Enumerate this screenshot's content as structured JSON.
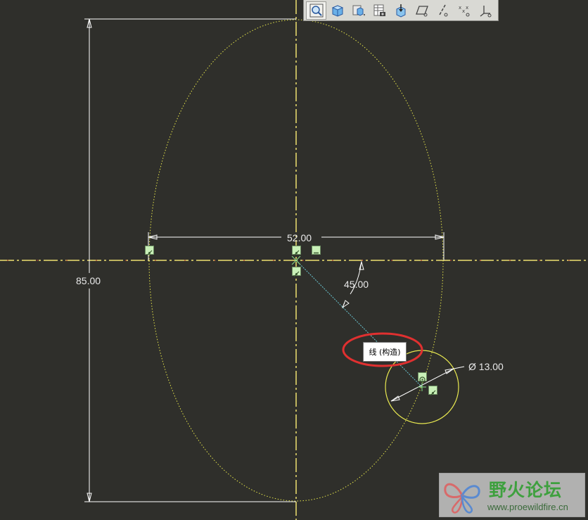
{
  "toolbar": {
    "buttons": [
      {
        "icon": "zoom-fit-icon",
        "active": true
      },
      {
        "icon": "shaded-view-icon"
      },
      {
        "icon": "saved-views-icon"
      },
      {
        "icon": "layer-table-icon"
      },
      {
        "icon": "reorient-sketch-icon"
      },
      {
        "icon": "datum-plane-display-icon"
      },
      {
        "icon": "datum-axis-display-icon"
      },
      {
        "icon": "datum-point-display-icon"
      },
      {
        "icon": "coordinate-system-display-icon"
      }
    ]
  },
  "dimensions": {
    "width": "52.00",
    "height": "85.00",
    "angle": "45.00",
    "diameter": "Ø 13.00"
  },
  "tooltip": {
    "text": "线 (构造)"
  },
  "watermark": {
    "title": "野火论坛",
    "url": "www.proewildfire.cn"
  },
  "colors": {
    "background": "#2f2f2b",
    "centerline": "#f0e26a",
    "sketch": "#e6e64a",
    "dimension": "#ffffff",
    "construction": "#5ab8c8",
    "highlight": "#e03030"
  }
}
